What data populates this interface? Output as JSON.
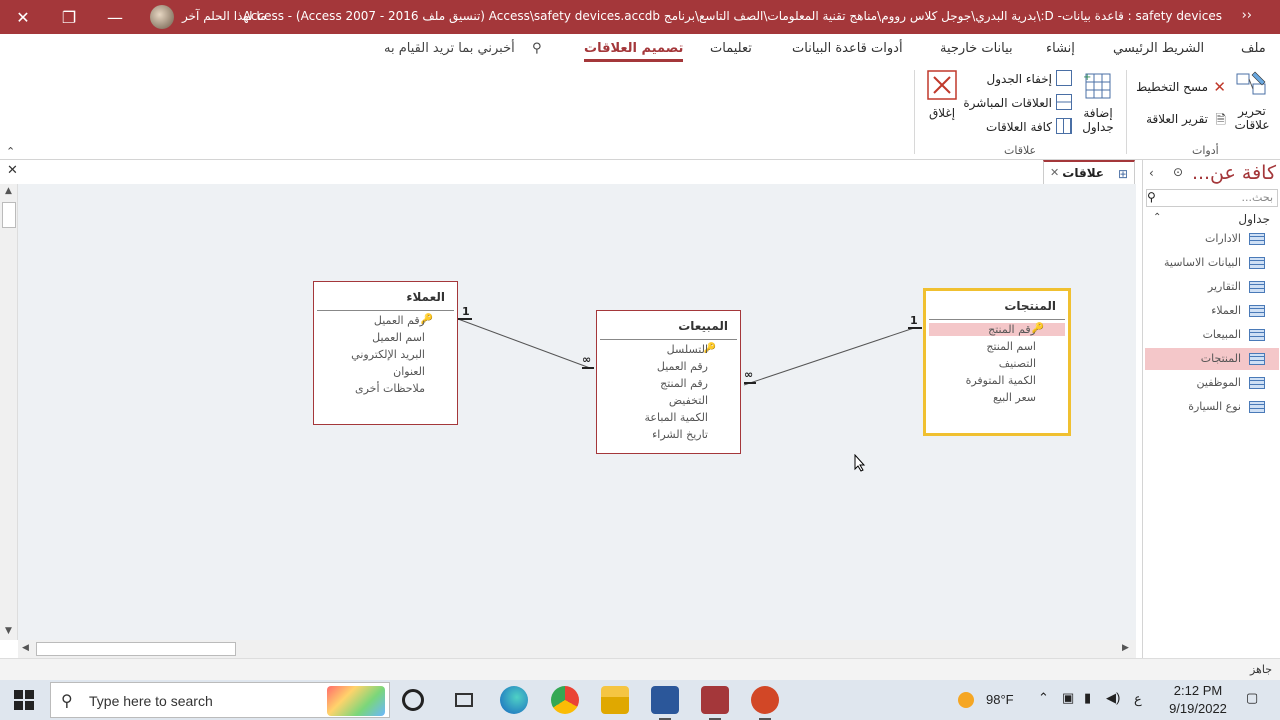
{
  "titlebar": {
    "title": "safety devices : قاعدة بيانات- D:\\بدرية البدري\\جوجل كلاس رووم\\مناهج تقنية المعلومات\\الصف التاسع\\برنامج Access\\safety devices.accdb (تنسيق ملف Access 2007 - 2016)  -  Access",
    "user": "ما لهذا الحلم آخر"
  },
  "tabs": {
    "file": "ملف",
    "home": "الشريط الرئيسي",
    "create": "إنشاء",
    "external": "بيانات خارجية",
    "dbtools": "أدوات قاعدة البيانات",
    "help": "تعليمات",
    "design": "تصميم العلاقات",
    "tellme": "أخبرني بما تريد القيام به"
  },
  "ribbon": {
    "edit_relationships": "تحرير علاقات",
    "clear_layout": "مسح التخطيط",
    "relationship_report": "تقرير العلاقة",
    "tools_group": "أدوات",
    "add_tables": "إضافة جداول",
    "hide_table": "إخفاء الجدول",
    "direct_relationships": "العلاقات المباشرة",
    "all_relationships": "كافة العلاقات",
    "relationships_group": "علاقات",
    "close": "إغلاق"
  },
  "nav": {
    "title": "كافة عن...",
    "search_placeholder": "بحث...",
    "group": "جداول",
    "items": [
      {
        "label": "الادارات"
      },
      {
        "label": "البيانات الاساسية"
      },
      {
        "label": "التقارير"
      },
      {
        "label": "العملاء"
      },
      {
        "label": "المبيعات"
      },
      {
        "label": "المنتجات"
      },
      {
        "label": "الموظفين"
      },
      {
        "label": "نوع السيارة"
      }
    ],
    "selected_index": 5
  },
  "doc_tab": {
    "label": "علاقات"
  },
  "tables": {
    "customers": {
      "title": "العملاء",
      "fields": [
        "رقم العميل",
        "اسم العميل",
        "البريد الإلكتروني",
        "العنوان",
        "ملاحظات أخرى"
      ]
    },
    "sales": {
      "title": "المبيعات",
      "fields": [
        "التسلسل",
        "رقم العميل",
        "رقم المنتج",
        "التخفيض",
        "الكمية المباعة",
        "تاريخ الشراء"
      ]
    },
    "products": {
      "title": "المنتجات",
      "fields": [
        "رقم المنتج",
        "اسم المنتج",
        "التصنيف",
        "الكمية المتوفرة",
        "سعر البيع"
      ]
    }
  },
  "relations": {
    "one": "1",
    "many": "∞"
  },
  "status": {
    "text": "جاهز"
  },
  "taskbar": {
    "search_placeholder": "Type here to search",
    "weather": "98°F",
    "lang": "ع",
    "time": "2:12 PM",
    "date": "9/19/2022"
  },
  "colors": {
    "accent": "#a4373a",
    "highlight": "#f4c7c9",
    "selected_border": "#f0c030"
  }
}
